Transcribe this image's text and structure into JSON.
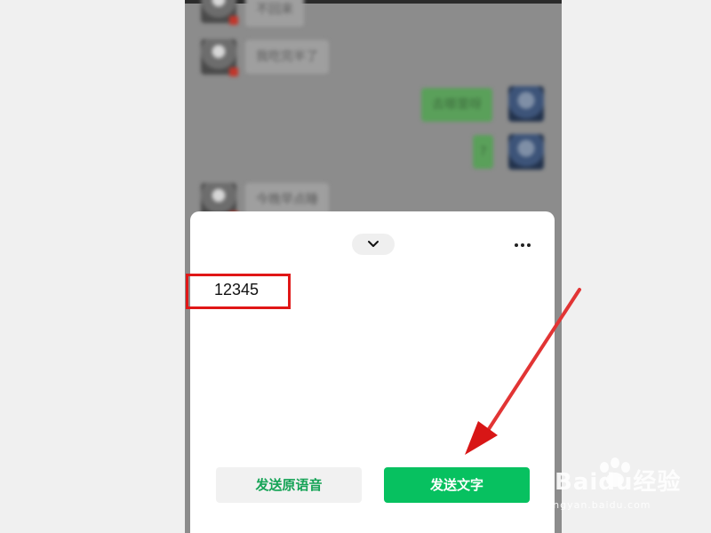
{
  "chat": {
    "messages": [
      {
        "side": "left",
        "text": "不回来"
      },
      {
        "side": "left",
        "text": "我吃完半了"
      },
      {
        "side": "right",
        "text": "去哪里呀"
      },
      {
        "side": "right",
        "text": "?"
      },
      {
        "side": "left",
        "text": "今晚早点睡"
      }
    ]
  },
  "sheet": {
    "collapse_icon": "chevron-down-icon",
    "more_icon": "more-icon",
    "transcript": "12345",
    "send_voice_label": "发送原语音",
    "send_text_label": "发送文字"
  },
  "colors": {
    "send_text_bg": "#07c160",
    "send_voice_text": "#15a356",
    "annotation": "#e01717"
  },
  "watermark": {
    "brand": "Baidu经验",
    "url": "jingyan.baidu.com"
  }
}
